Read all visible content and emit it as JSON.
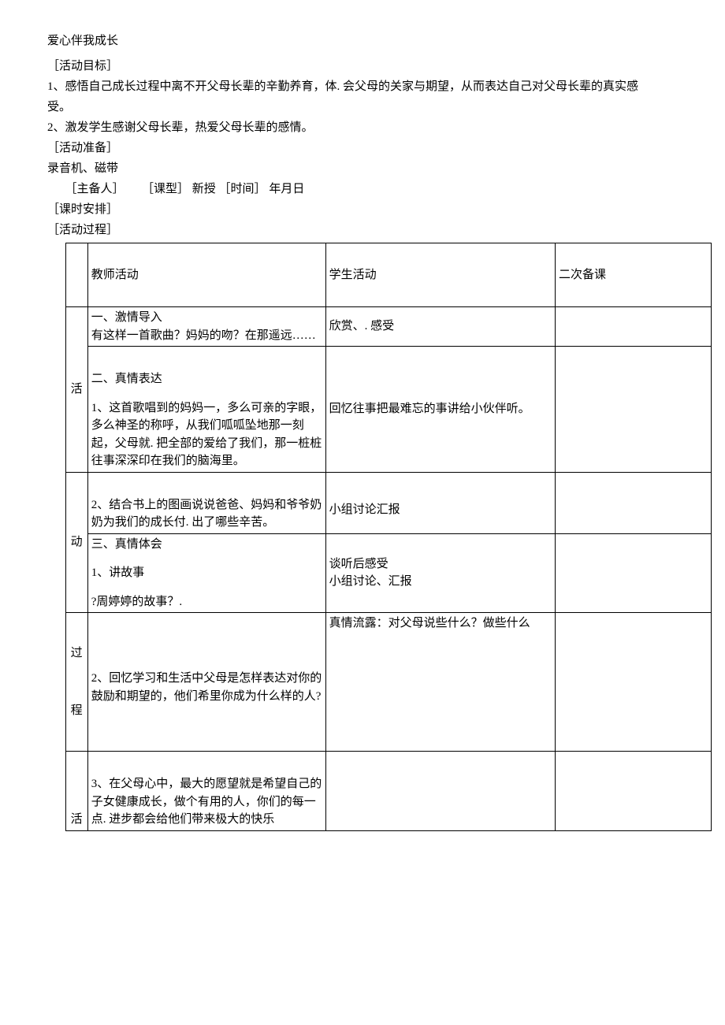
{
  "title": "爱心伴我成长",
  "labels": {
    "goal": "［活动目标］",
    "prep": "［活动准备］",
    "author": "［主备人］",
    "type_label": "［课型］",
    "type_val": "新授",
    "time_label": "［时间］",
    "time_val": "年月日",
    "schedule": "［课时安排］",
    "process": "［活动过程］"
  },
  "goals": {
    "g1a": "1、感悟自己成长过程中离不开父母长辈的辛勤养育，体. 会父母的关家与期望，从而表达自己对父母长辈的真实感",
    "g1b": "受。",
    "g2": "2、激发学生感谢父母长辈，热爱父母长辈的感情。"
  },
  "prep": {
    "p1": "录音机、磁带"
  },
  "table": {
    "headers": {
      "left_blank": "",
      "teacher": "教师活动",
      "student": "学生活动",
      "note": "二次备课"
    },
    "left": {
      "r1": "活",
      "r2": "动",
      "r3": "过",
      "r4": "程",
      "r5": "活"
    },
    "teacher": {
      "sec1_h": "一、激情导入",
      "sec1_t": "有这样一首歌曲？妈妈的吻？在那遥远……",
      "sec2_h": "二、真情表达",
      "sec2_t1": "1、这首歌唱到的妈妈一，多么可亲的字眼，多么神圣的称呼，从我们呱呱坠地那一刻起，父母就. 把全部的爱给了我们，那一桩桩往事深深印在我们的脑海里。",
      "sec2_t2": "2、结合书上的图画说说爸爸、妈妈和爷爷奶奶为我们的成长付. 出了哪些辛苦。",
      "sec3_h": "三、真情体会",
      "sec3_t1": "1、讲故事",
      "sec3_t1b": "?周婷婷的故事？.",
      "sec3_t2": "2、回忆学习和生活中父母是怎样表达对你的鼓励和期望的，他们希里你成为什么样的人?",
      "sec3_t3": "3、在父母心中，最大的愿望就是希望自己的子女健康成长，做个有用的人，你们的每一点. 进步都会给他们带来极大的快乐"
    },
    "student": {
      "s1": "欣赏、. 感受",
      "s2": "回忆往事把最难忘的事讲给小伙伴听。",
      "s3": "小组讨论汇报",
      "s4a": "谈听后感受",
      "s4b": "小组讨论、汇报",
      "s5": "真情流露：对父母说些什么？做些什么"
    }
  }
}
